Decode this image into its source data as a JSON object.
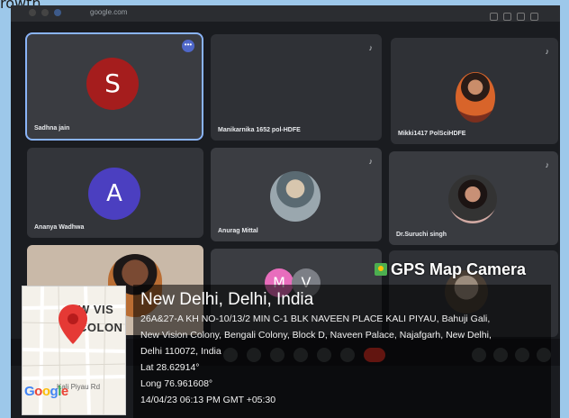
{
  "caption": "rowth",
  "browser": {
    "url": "google.com"
  },
  "tiles": [
    {
      "name": "Sadhna jain",
      "initial": "S",
      "color": "#a51d1d"
    },
    {
      "name": "Manikarnika 1652 pol-HDFE"
    },
    {
      "name": "Mikki1417 PolSciHDFE"
    },
    {
      "name": "Ananya Wadhwa",
      "initial": "A",
      "color": "#4b3fc0"
    },
    {
      "name": "Anurag Mittal"
    },
    {
      "name": "Dr.Suruchi singh"
    }
  ],
  "bottom_initials": [
    "M",
    "V"
  ],
  "gps": {
    "brand": "GPS Map Camera",
    "place": "New Delhi, Delhi, India",
    "address_lines": [
      "26A&27-A KH NO-10/13/2 MIN C-1 BLK NAVEEN PLACE KALI PIYAU, Bahuji Gali,",
      "New Vision Colony, Bengali Colony, Block D, Naveen Palace, Najafgarh, New Delhi,",
      "Delhi 110072, India"
    ],
    "lat": "Lat 28.62914°",
    "long": "Long 76.961608°",
    "datetime": "14/04/23 06:13 PM GMT +05:30"
  },
  "map": {
    "label_1": "W VIS",
    "label_2": "COLON",
    "street": "Kali Piyau Rd",
    "logo": "Google",
    "pin_color": "#e53935"
  }
}
